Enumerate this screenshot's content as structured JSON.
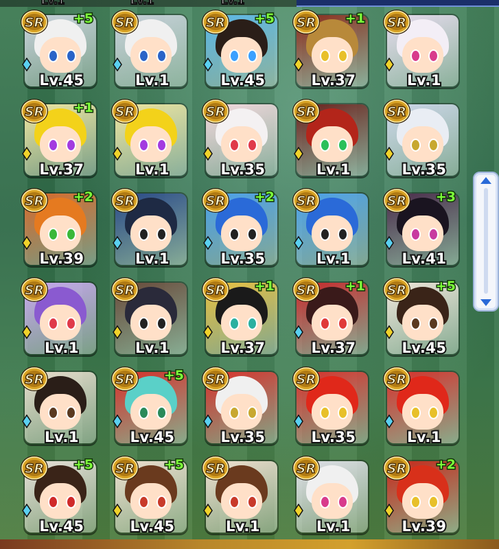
{
  "top_partial_levels": [
    "Lv.1",
    "Lv.1",
    "Lv.1"
  ],
  "rarity_label": "SR",
  "cards": [
    {
      "level": "Lv.45",
      "plus": "+5",
      "gem": "blue",
      "hair": "#f0f0f0",
      "bg": "#c9d2dc",
      "eye": "#2a64c8"
    },
    {
      "level": "Lv.1",
      "plus": "",
      "gem": "blue",
      "hair": "#f0f0f0",
      "bg": "#c9d2dc",
      "eye": "#2a64c8"
    },
    {
      "level": "Lv.45",
      "plus": "+5",
      "gem": "blue",
      "hair": "#2a1e18",
      "bg": "#5bb7e8",
      "eye": "#3aa0ff"
    },
    {
      "level": "Lv.37",
      "plus": "+1",
      "gem": "yellow",
      "hair": "#b8893a",
      "bg": "#8a2a1a",
      "eye": "#e8c02a"
    },
    {
      "level": "Lv.1",
      "plus": "",
      "gem": "yellow",
      "hair": "#f3eef6",
      "bg": "#e7dcef",
      "eye": "#d83b8c"
    },
    {
      "level": "Lv.37",
      "plus": "+1",
      "gem": "yellow",
      "hair": "#f3d21a",
      "bg": "#f0e6a0",
      "eye": "#a33be0"
    },
    {
      "level": "Lv.1",
      "plus": "",
      "gem": "yellow",
      "hair": "#f3d21a",
      "bg": "#f0e6a0",
      "eye": "#a33be0"
    },
    {
      "level": "Lv.35",
      "plus": "",
      "gem": "yellow",
      "hair": "#f4f1f2",
      "bg": "#f4d8de",
      "eye": "#e03a4a"
    },
    {
      "level": "Lv.1",
      "plus": "",
      "gem": "yellow",
      "hair": "#b3251a",
      "bg": "#6a1f1a",
      "eye": "#2ac05a"
    },
    {
      "level": "Lv.35",
      "plus": "",
      "gem": "yellow",
      "hair": "#e9edf4",
      "bg": "#cdd7ea",
      "eye": "#c8a830"
    },
    {
      "level": "Lv.39",
      "plus": "+2",
      "gem": "yellow",
      "hair": "#e57a20",
      "bg": "#d96a2a",
      "eye": "#3ab83a"
    },
    {
      "level": "Lv.1",
      "plus": "",
      "gem": "blue",
      "hair": "#1e2a44",
      "bg": "#2a4a8a",
      "eye": "#222222"
    },
    {
      "level": "Lv.35",
      "plus": "+2",
      "gem": "blue",
      "hair": "#2a6ad8",
      "bg": "#4aa0ea",
      "eye": "#222222"
    },
    {
      "level": "Lv.1",
      "plus": "",
      "gem": "blue",
      "hair": "#2a6ad8",
      "bg": "#4aa0ea",
      "eye": "#222222"
    },
    {
      "level": "Lv.41",
      "plus": "+3",
      "gem": "blue",
      "hair": "#1a1420",
      "bg": "#4a2a4a",
      "eye": "#c83aa0"
    },
    {
      "level": "Lv.1",
      "plus": "",
      "gem": "yellow",
      "hair": "#8a5ad0",
      "bg": "#c8a8f0",
      "eye": "#e03a4a"
    },
    {
      "level": "Lv.1",
      "plus": "",
      "gem": "yellow",
      "hair": "#2a2a3a",
      "bg": "#6a4a3a",
      "eye": "#222222"
    },
    {
      "level": "Lv.37",
      "plus": "+1",
      "gem": "yellow",
      "hair": "#1a1a1a",
      "bg": "#e8c040",
      "eye": "#2ab0a0"
    },
    {
      "level": "Lv.37",
      "plus": "+1",
      "gem": "blue",
      "hair": "#3a1a1a",
      "bg": "#c8282a",
      "eye": "#e03a3a"
    },
    {
      "level": "Lv.45",
      "plus": "+5",
      "gem": "yellow",
      "hair": "#3a2418",
      "bg": "#f0e6da",
      "eye": "#5a3a20"
    },
    {
      "level": "Lv.1",
      "plus": "",
      "gem": "blue",
      "hair": "#2a1e18",
      "bg": "#e8dccc",
      "eye": "#5a3a20"
    },
    {
      "level": "Lv.45",
      "plus": "+5",
      "gem": "blue",
      "hair": "#5ad0c8",
      "bg": "#d8302a",
      "eye": "#2a8a5a"
    },
    {
      "level": "Lv.35",
      "plus": "",
      "gem": "blue",
      "hair": "#f0f0f0",
      "bg": "#d8302a",
      "eye": "#c8a830"
    },
    {
      "level": "Lv.35",
      "plus": "",
      "gem": "blue",
      "hair": "#e0281a",
      "bg": "#d8302a",
      "eye": "#e8c02a"
    },
    {
      "level": "Lv.1",
      "plus": "",
      "gem": "blue",
      "hair": "#e0281a",
      "bg": "#d8302a",
      "eye": "#e8c02a"
    },
    {
      "level": "Lv.45",
      "plus": "+5",
      "gem": "blue",
      "hair": "#3a2418",
      "bg": "#e8e0d8",
      "eye": "#d02a2a"
    },
    {
      "level": "Lv.45",
      "plus": "+5",
      "gem": "yellow",
      "hair": "#6a3a1e",
      "bg": "#f0e0d0",
      "eye": "#c83a2a"
    },
    {
      "level": "Lv.1",
      "plus": "",
      "gem": "yellow",
      "hair": "#6a3a1e",
      "bg": "#f0e0d0",
      "eye": "#c83a2a"
    },
    {
      "level": "Lv.1",
      "plus": "",
      "gem": "yellow",
      "hair": "#f0f0f0",
      "bg": "#e0e0e8",
      "eye": "#d83b8c"
    },
    {
      "level": "Lv.39",
      "plus": "+2",
      "gem": "yellow",
      "hair": "#d8301a",
      "bg": "#c8281a",
      "eye": "#e8c02a"
    }
  ]
}
